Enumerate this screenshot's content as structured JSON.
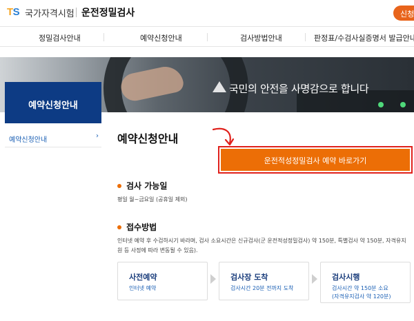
{
  "header": {
    "logo_t": "T",
    "logo_s": "S",
    "org_name": "국가자격시험",
    "site_title": "운전정밀검사",
    "top_button": "신청하기"
  },
  "nav": {
    "items": [
      "정밀검사안내",
      "예약신청안내",
      "검사방법안내",
      "판정표/수검사실증명서 발급안내"
    ]
  },
  "banner": {
    "slogan": "국민의 안전을 사명감으로 합니다"
  },
  "sidebar": {
    "title": "예약신청안내",
    "items": [
      {
        "label": "예약신청안내",
        "arrow": "›"
      }
    ]
  },
  "main": {
    "page_title": "예약신청안내",
    "cta_label": "운전적성정밀검사 예약 바로가기",
    "sections": [
      {
        "heading": "검사 가능일",
        "text": "평일 월~금요일 (공휴일 제외)"
      },
      {
        "heading": "접수방법",
        "text_line1": "인터넷 예약 후 수검하시기 바라며, 검사 소요시간은 신규검사(군 운전적성정밀검사) 약 150분, 특별검사 약 150분, 자격유지",
        "text_line2": "원 등 사정에 따라 변동될 수 있음)."
      }
    ],
    "steps": [
      {
        "title": "사전예약",
        "desc": "인터넷 예약"
      },
      {
        "title": "검사장 도착",
        "desc": "검사시간 20분 전까지 도착"
      },
      {
        "title": "검사시행",
        "desc": "검사시간 약 150분 소요",
        "desc2": "(자격유지검사 약 120분)"
      }
    ]
  },
  "colors": {
    "brand_navy": "#0d3b84",
    "cta_orange": "#ec6e06",
    "highlight_red": "#e0201b",
    "link_blue": "#1a5fb4"
  }
}
